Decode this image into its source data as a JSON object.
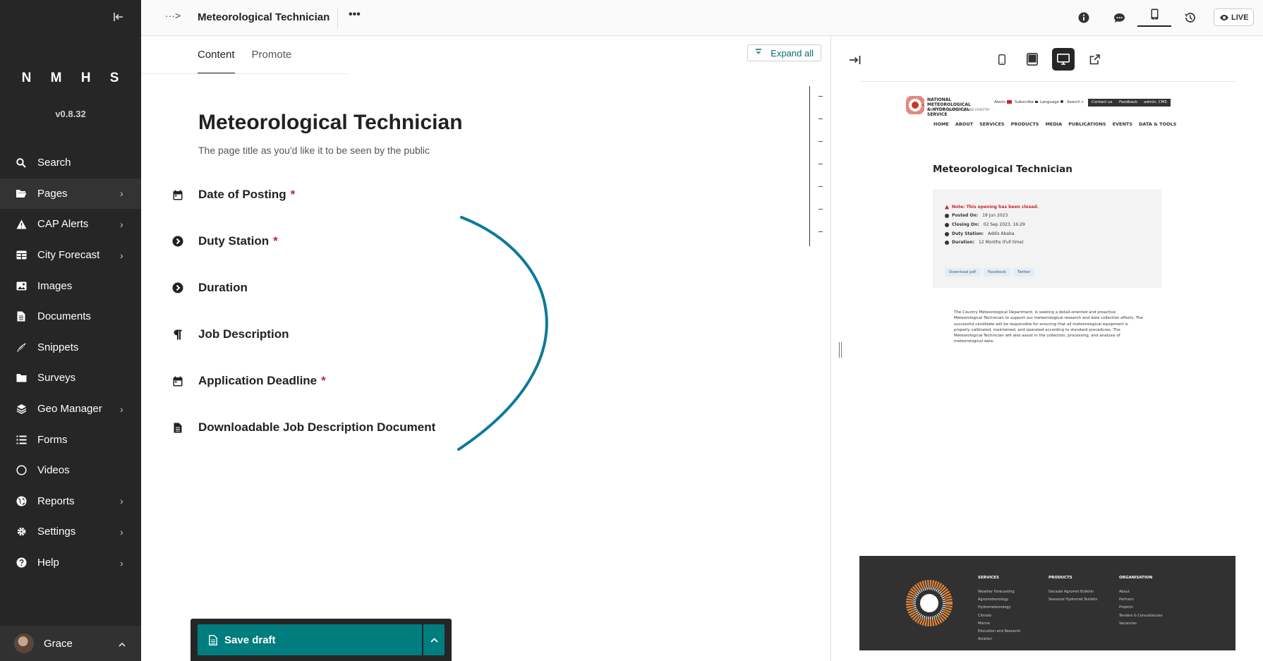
{
  "sidebar": {
    "brand": "N M H S",
    "version": "v0.8.32",
    "items": [
      {
        "label": "Search",
        "icon": "search-icon",
        "has_submenu": false
      },
      {
        "label": "Pages",
        "icon": "folder-open-icon",
        "has_submenu": true
      },
      {
        "label": "CAP Alerts",
        "icon": "warning-icon",
        "has_submenu": true
      },
      {
        "label": "City Forecast",
        "icon": "table-icon",
        "has_submenu": true
      },
      {
        "label": "Images",
        "icon": "image-icon",
        "has_submenu": false
      },
      {
        "label": "Documents",
        "icon": "document-icon",
        "has_submenu": false
      },
      {
        "label": "Snippets",
        "icon": "snippet-icon",
        "has_submenu": false
      },
      {
        "label": "Surveys",
        "icon": "folder-icon",
        "has_submenu": false
      },
      {
        "label": "Geo Manager",
        "icon": "layers-icon",
        "has_submenu": true
      },
      {
        "label": "Forms",
        "icon": "list-icon",
        "has_submenu": false
      },
      {
        "label": "Videos",
        "icon": "circle-icon",
        "has_submenu": false
      },
      {
        "label": "Reports",
        "icon": "globe-icon",
        "has_submenu": true
      },
      {
        "label": "Settings",
        "icon": "cog-icon",
        "has_submenu": true
      },
      {
        "label": "Help",
        "icon": "help-icon",
        "has_submenu": true
      }
    ],
    "account": {
      "name": "Grace"
    }
  },
  "header": {
    "breadcrumb_toggle": "···>",
    "page_title": "Meteorological Technician",
    "more": "•••",
    "live_label": "LIVE"
  },
  "editor": {
    "tabs": [
      {
        "label": "Content",
        "active": true
      },
      {
        "label": "Promote",
        "active": false
      }
    ],
    "expand_all": "Expand all",
    "title": "Meteorological Technician",
    "title_help": "The page title as you'd like it to be seen by the public",
    "fields": [
      {
        "label": "Date of Posting",
        "required": true,
        "icon": "calendar-icon"
      },
      {
        "label": "Duty Station",
        "required": true,
        "icon": "arrow-circle-icon"
      },
      {
        "label": "Duration",
        "required": false,
        "icon": "arrow-circle-icon"
      },
      {
        "label": "Job Description",
        "required": false,
        "icon": "pilcrow-icon"
      },
      {
        "label": "Application Deadline",
        "required": true,
        "icon": "calendar-icon"
      },
      {
        "label": "Downloadable Job Description Document",
        "required": false,
        "icon": "document-icon"
      }
    ],
    "required_mark": "*",
    "save_draft": "Save draft"
  },
  "preview": {
    "site": {
      "name_line1": "NATIONAL METEOROLOGICAL",
      "name_line2": "& HYDROLOGICAL SERVICE",
      "tagline": "MINISTRY OF ENVIRONMENT AND FORESTRY",
      "util": {
        "alerts": "Alerts",
        "subscribe": "Subscribe",
        "language": "Language",
        "search": "Search"
      },
      "util_buttons": [
        "Contact us",
        "Feedback",
        "admin, CMS"
      ],
      "nav": [
        "HOME",
        "ABOUT",
        "SERVICES",
        "PRODUCTS",
        "MEDIA",
        "PUBLICATIONS",
        "EVENTS",
        "DATA & TOOLS"
      ],
      "title": "Meteorological Technician",
      "closed_note": "Note: This opening has been closed.",
      "posted_label": "Posted On:",
      "posted_value": "19 Jun 2023",
      "closing_label": "Closing On:",
      "closing_value": "02 Sep 2023, 16:29",
      "station_label": "Duty Station:",
      "station_value": "Addis Ababa",
      "duration_label": "Duration:",
      "duration_value": "12 Months (Full time)",
      "share": [
        "Download pdf",
        "Facebook",
        "Twitter"
      ],
      "body": "The Country Meteorological Department, is seeking a detail-oriented and proactive Meteorological Technician to support our meteorological research and data collection efforts. The successful candidate will be responsible for ensuring that all meteorological equipment is properly calibrated, maintained, and operated according to standard procedures. The Meteorological Technician will also assist in the collection, processing, and analysis of meteorological data.",
      "footer": {
        "services": {
          "heading": "SERVICES",
          "items": [
            "Weather Forecasting",
            "Agrometeorology",
            "Hydrometeorology",
            "Climate",
            "Marine",
            "Education and Research",
            "Aviation"
          ]
        },
        "products": {
          "heading": "PRODUCTS",
          "items": [
            "Decadal Agromet Bulletin",
            "Seasonal Hydromet Bulletin"
          ]
        },
        "organisation": {
          "heading": "ORGANISATION",
          "items": [
            "About",
            "Partners",
            "Projects",
            "Tenders & Consultancies",
            "Vacancies"
          ]
        }
      }
    }
  },
  "colors": {
    "sidebar_bg": "#262626",
    "accent": "#007d7e",
    "required": "#c9203a",
    "annotation_curve": "#0e7a9a"
  }
}
